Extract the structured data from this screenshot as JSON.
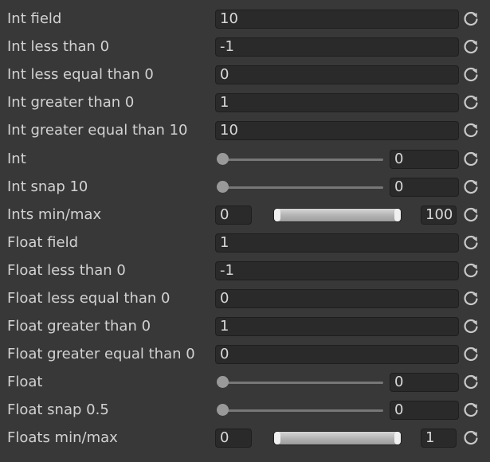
{
  "rows": [
    {
      "label": "Int field",
      "type": "field",
      "value": "10"
    },
    {
      "label": "Int less than 0",
      "type": "field",
      "value": "-1"
    },
    {
      "label": "Int less equal than 0",
      "type": "field",
      "value": "0"
    },
    {
      "label": "Int greater than 0",
      "type": "field",
      "value": "1"
    },
    {
      "label": "Int greater equal than 10",
      "type": "field",
      "value": "10"
    },
    {
      "label": "Int",
      "type": "slider",
      "value": "0",
      "slider_fraction": 0
    },
    {
      "label": "Int snap 10",
      "type": "slider",
      "value": "0",
      "slider_fraction": 0
    },
    {
      "label": "Ints min/max",
      "type": "minmax",
      "min": "0",
      "max": "100"
    },
    {
      "label": "Float field",
      "type": "field",
      "value": "1"
    },
    {
      "label": "Float less than 0",
      "type": "field",
      "value": "-1"
    },
    {
      "label": "Float less equal than 0",
      "type": "field",
      "value": "0"
    },
    {
      "label": "Float greater than 0",
      "type": "field",
      "value": "1"
    },
    {
      "label": "Float greater equal than 0",
      "type": "field",
      "value": "0"
    },
    {
      "label": "Float",
      "type": "slider",
      "value": "0",
      "slider_fraction": 0
    },
    {
      "label": "Float snap 0.5",
      "type": "slider",
      "value": "0",
      "slider_fraction": 0
    },
    {
      "label": "Floats min/max",
      "type": "minmax",
      "min": "0",
      "max": "1"
    }
  ],
  "icons": {
    "reset": "reset-icon"
  },
  "colors": {
    "background": "#383838",
    "field": "#2a2a2a",
    "text": "#d2d2d2",
    "icon": "#c8c8c8"
  }
}
